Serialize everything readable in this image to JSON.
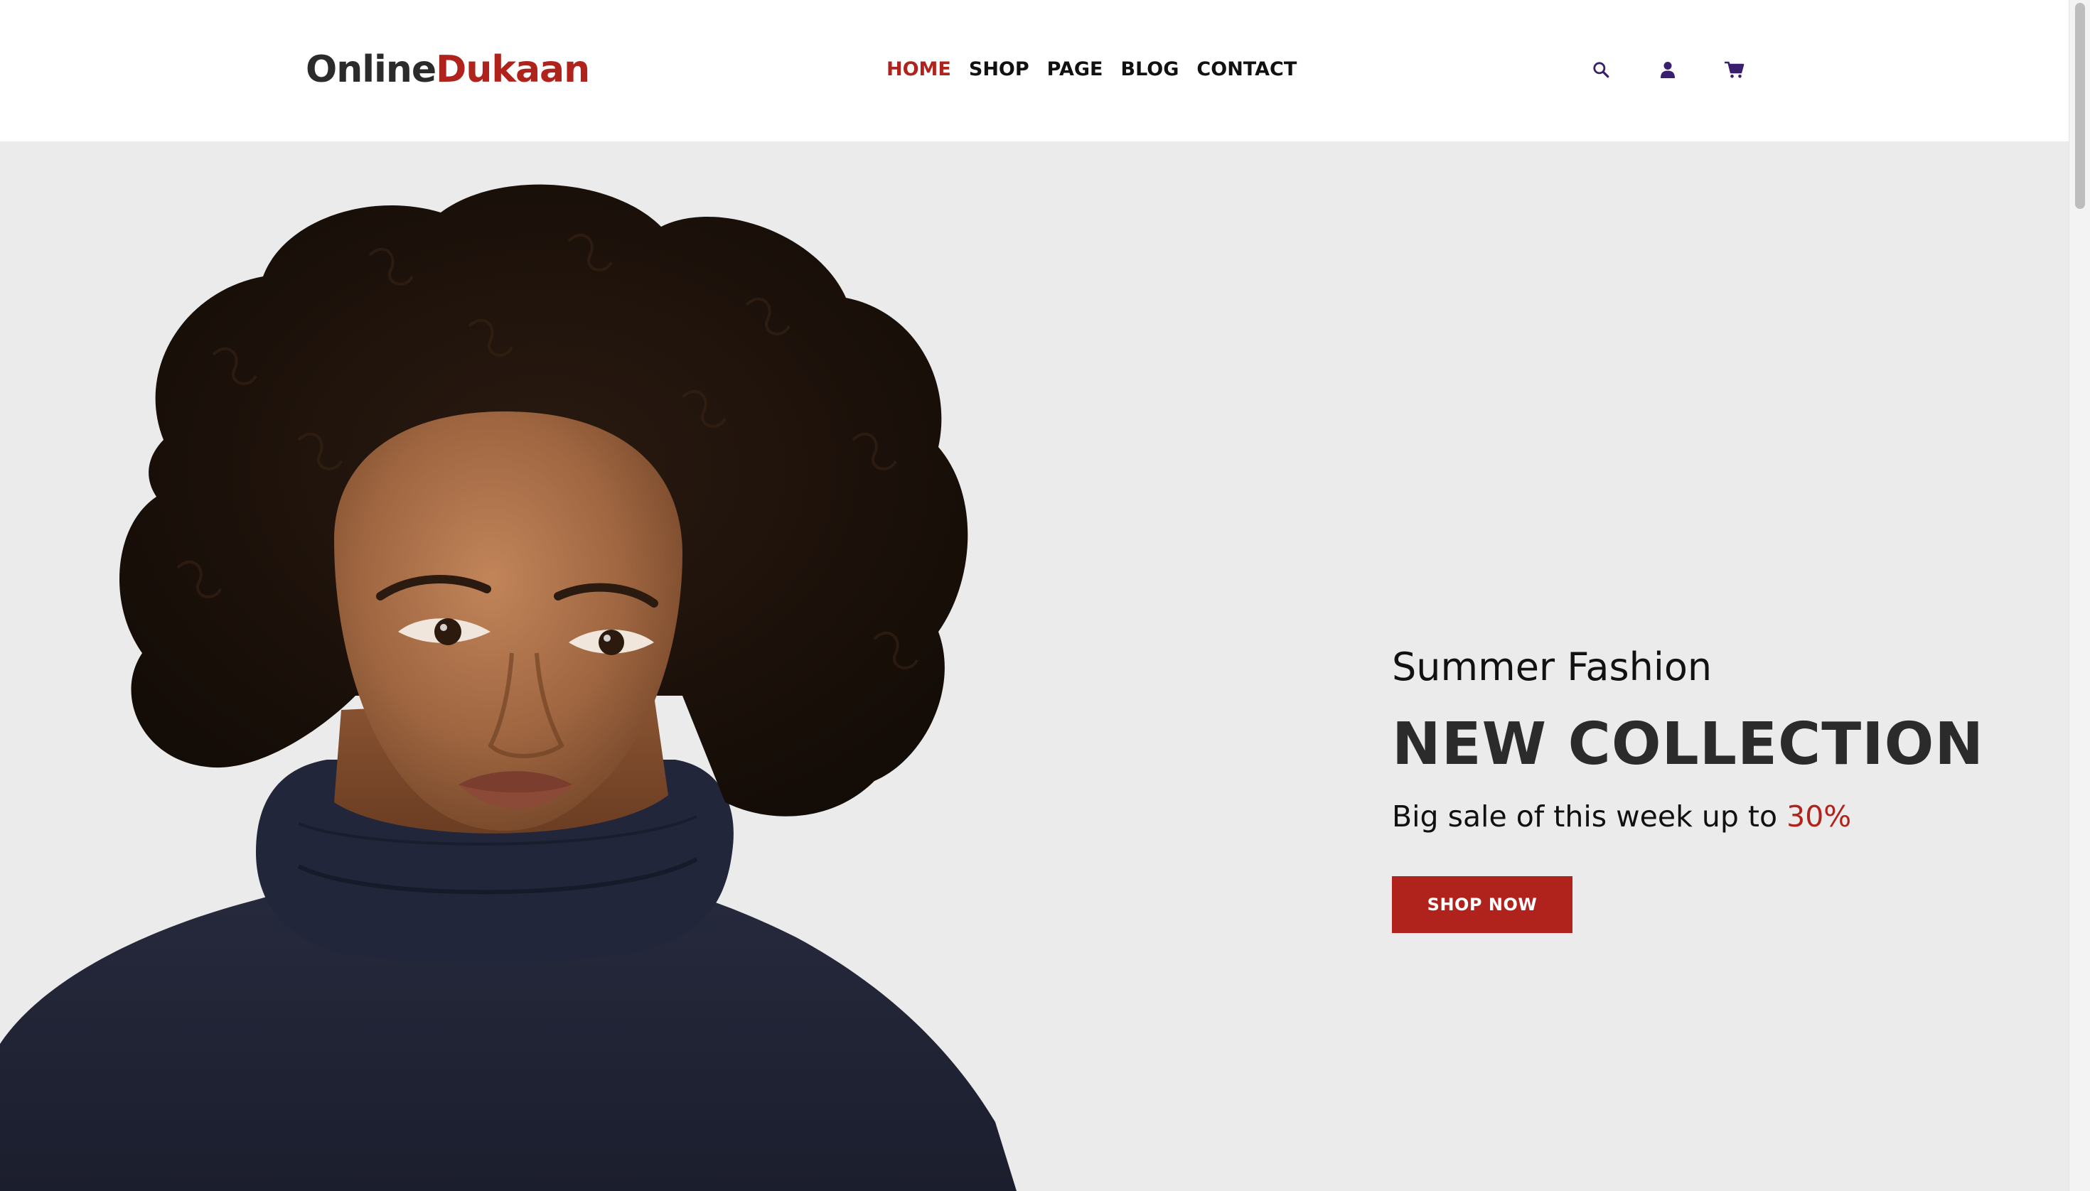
{
  "brand": {
    "part1": "Online",
    "part2": "Dukaan",
    "accent_color": "#b0231c"
  },
  "nav": {
    "items": [
      {
        "label": "HOME",
        "active": true
      },
      {
        "label": "SHOP",
        "active": false
      },
      {
        "label": "PAGE",
        "active": false
      },
      {
        "label": "BLOG",
        "active": false
      },
      {
        "label": "CONTACT",
        "active": false
      }
    ]
  },
  "header_icons": {
    "search": "search-icon",
    "account": "user-icon",
    "cart": "cart-icon",
    "icon_color": "#3a1f6e"
  },
  "hero": {
    "subtitle": "Summer Fashion",
    "headline": "NEW COLLECTION",
    "sale_text": "Big sale of this week up to ",
    "sale_percent": "30%",
    "cta_label": "SHOP NOW",
    "background_color": "#ebebeb",
    "image": "model-photo"
  }
}
